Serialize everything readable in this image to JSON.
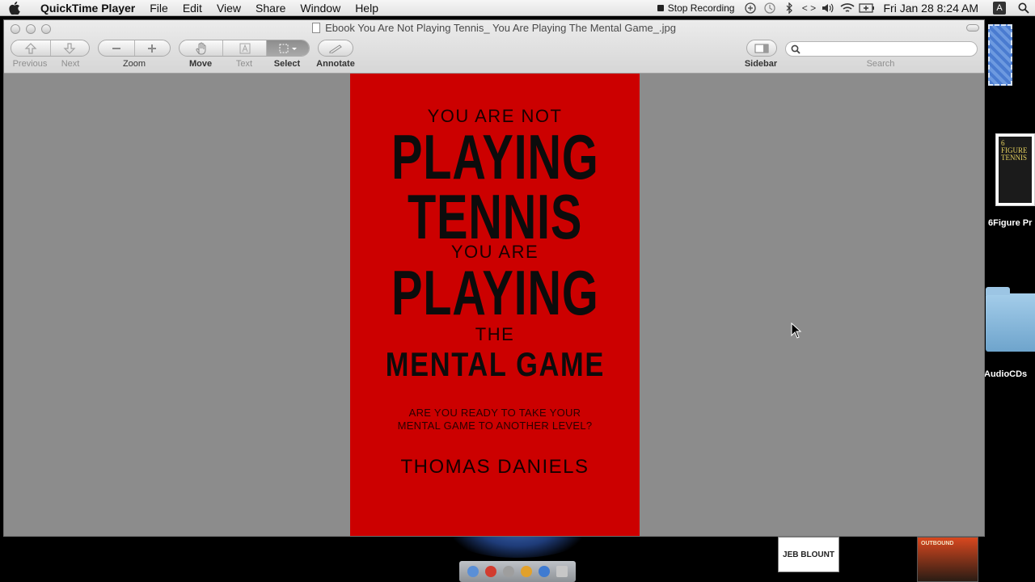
{
  "menubar": {
    "app_name": "QuickTime Player",
    "items": [
      "File",
      "Edit",
      "View",
      "Share",
      "Window",
      "Help"
    ],
    "stop_recording": "Stop Recording",
    "clock": "Fri Jan 28  8:24 AM",
    "user_initial": "A"
  },
  "window": {
    "title": "Ebook You Are Not Playing Tennis_ You Are Playing The Mental Game_.jpg"
  },
  "toolbar": {
    "previous_label": "Previous",
    "next_label": "Next",
    "zoom_label": "Zoom",
    "move_label": "Move",
    "text_label": "Text",
    "select_label": "Select",
    "annotate_label": "Annotate",
    "sidebar_label": "Sidebar",
    "search_label": "Search",
    "search_value": ""
  },
  "cover": {
    "line1": "YOU ARE NOT",
    "line2": "PLAYING",
    "line3": "TENNIS",
    "line4": "YOU ARE",
    "line5": "PLAYING",
    "line6": "THE",
    "line7": "MENTAL GAME",
    "tagline1": "ARE YOU READY TO TAKE YOUR",
    "tagline2": "MENTAL GAME TO ANOTHER LEVEL?",
    "author": "THOMAS DANIELS"
  },
  "desktop": {
    "icon1_label": "6Figure Pr",
    "icon1_thumb": "6 FIGURE TENNIS",
    "icon2_label": "AudioCDs",
    "book1_label": "JEB BLOUNT",
    "book2_label": "OUTBOUND"
  }
}
